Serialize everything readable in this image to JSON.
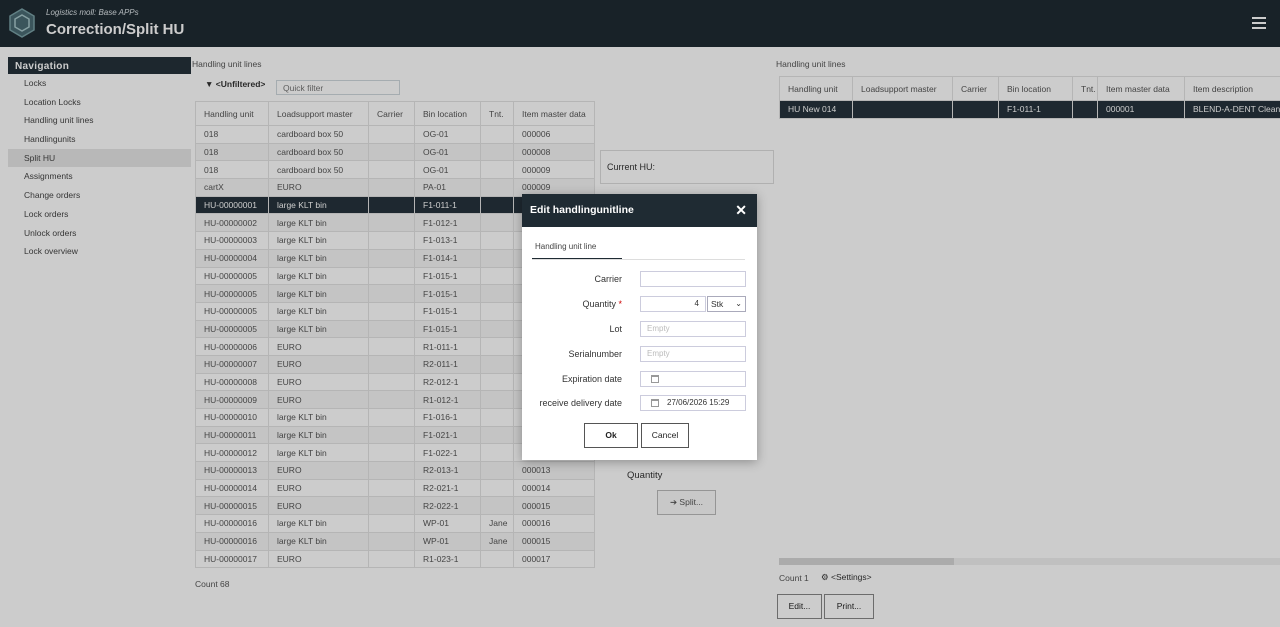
{
  "header": {
    "subtitle": "Logistics moll: Base APPs",
    "title": "Correction/Split HU"
  },
  "nav": {
    "heading": "Navigation",
    "items": [
      "Locks",
      "Location Locks",
      "Handling unit lines",
      "Handlingunits",
      "Split HU",
      "Assignments",
      "Change orders",
      "Lock orders",
      "Unlock orders",
      "Lock overview"
    ]
  },
  "left_grid": {
    "section_label": "Handling unit lines",
    "filter_label": "<Unfiltered>",
    "quick_filter_placeholder": "Quick filter",
    "columns": [
      "Handling unit",
      "Loadsupport master",
      "Carrier",
      "Bin location",
      "Tnt.",
      "Item master data"
    ],
    "rows": [
      [
        "018",
        "cardboard box 50",
        "",
        "OG-01",
        "",
        "000006"
      ],
      [
        "018",
        "cardboard box 50",
        "",
        "OG-01",
        "",
        "000008"
      ],
      [
        "018",
        "cardboard box 50",
        "",
        "OG-01",
        "",
        "000009"
      ],
      [
        "cartX",
        "EURO",
        "",
        "PA-01",
        "",
        "000009"
      ],
      [
        "HU-00000001",
        "large KLT bin",
        "",
        "F1-011-1",
        "",
        ""
      ],
      [
        "HU-00000002",
        "large KLT bin",
        "",
        "F1-012-1",
        "",
        ""
      ],
      [
        "HU-00000003",
        "large KLT bin",
        "",
        "F1-013-1",
        "",
        ""
      ],
      [
        "HU-00000004",
        "large KLT bin",
        "",
        "F1-014-1",
        "",
        ""
      ],
      [
        "HU-00000005",
        "large KLT bin",
        "",
        "F1-015-1",
        "",
        ""
      ],
      [
        "HU-00000005",
        "large KLT bin",
        "",
        "F1-015-1",
        "",
        ""
      ],
      [
        "HU-00000005",
        "large KLT bin",
        "",
        "F1-015-1",
        "",
        ""
      ],
      [
        "HU-00000005",
        "large KLT bin",
        "",
        "F1-015-1",
        "",
        ""
      ],
      [
        "HU-00000006",
        "EURO",
        "",
        "R1-011-1",
        "",
        ""
      ],
      [
        "HU-00000007",
        "EURO",
        "",
        "R2-011-1",
        "",
        ""
      ],
      [
        "HU-00000008",
        "EURO",
        "",
        "R2-012-1",
        "",
        ""
      ],
      [
        "HU-00000009",
        "EURO",
        "",
        "R1-012-1",
        "",
        ""
      ],
      [
        "HU-00000010",
        "large KLT bin",
        "",
        "F1-016-1",
        "",
        ""
      ],
      [
        "HU-00000011",
        "large KLT bin",
        "",
        "F1-021-1",
        "",
        ""
      ],
      [
        "HU-00000012",
        "large KLT bin",
        "",
        "F1-022-1",
        "",
        ""
      ],
      [
        "HU-00000013",
        "EURO",
        "",
        "R2-013-1",
        "",
        "000013"
      ],
      [
        "HU-00000014",
        "EURO",
        "",
        "R2-021-1",
        "",
        "000014"
      ],
      [
        "HU-00000015",
        "EURO",
        "",
        "R2-022-1",
        "",
        "000015"
      ],
      [
        "HU-00000016",
        "large KLT bin",
        "",
        "WP-01",
        "Jane",
        "000016"
      ],
      [
        "HU-00000016",
        "large KLT bin",
        "",
        "WP-01",
        "Jane",
        "000015"
      ],
      [
        "HU-00000017",
        "EURO",
        "",
        "R1-023-1",
        "",
        "000017"
      ]
    ],
    "count": "Count 68"
  },
  "middle": {
    "current_hu_label": "Current HU:",
    "quantity_label": "Quantity",
    "split_label": "Split..."
  },
  "right_grid": {
    "section_label": "Handling unit lines",
    "columns": [
      "Handling unit",
      "Loadsupport master",
      "Carrier",
      "Bin location",
      "Tnt.",
      "Item master data",
      "Item description"
    ],
    "rows": [
      [
        "HU New 014",
        "",
        "",
        "F1-011-1",
        "",
        "000001",
        "BLEND-A-DENT Cleans"
      ]
    ],
    "count": "Count 1",
    "settings_label": "<Settings>",
    "edit_label": "Edit...",
    "print_label": "Print..."
  },
  "dialog": {
    "title": "Edit handlingunitline",
    "tab": "Handling unit line",
    "carrier_label": "Carrier",
    "quantity_label": "Quantity",
    "quantity_value": "4",
    "unit_value": "Stk",
    "lot_label": "Lot",
    "lot_placeholder": "Empty",
    "serial_label": "Serialnumber",
    "serial_placeholder": "Empty",
    "expiration_label": "Expiration date",
    "receive_label": "receive delivery date",
    "receive_value": "27/06/2026 15:29",
    "ok_label": "Ok",
    "cancel_label": "Cancel"
  }
}
